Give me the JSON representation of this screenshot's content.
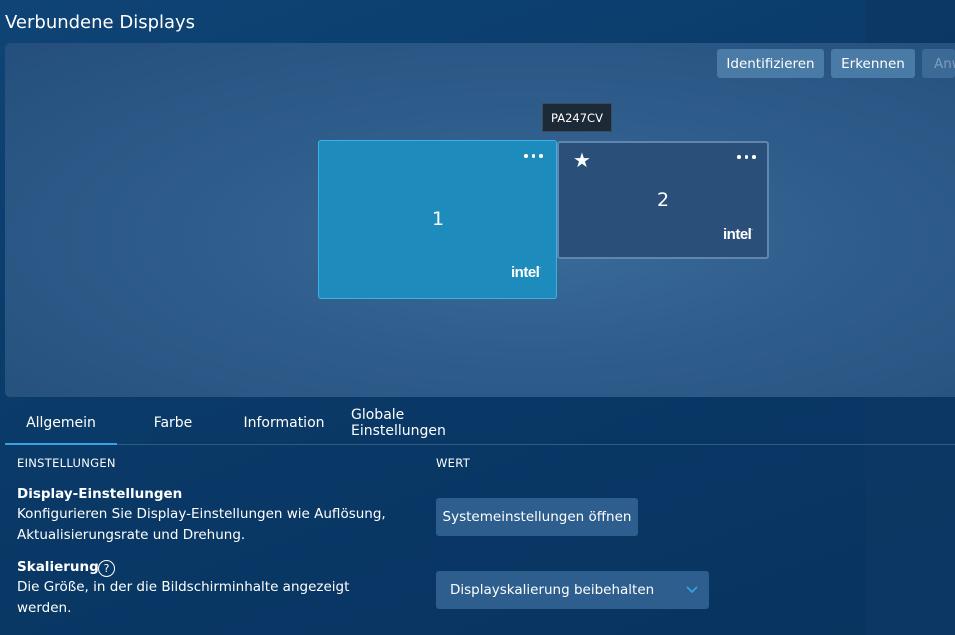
{
  "header": {
    "title": "Verbundene Displays"
  },
  "toolbar": {
    "identify_label": "Identifizieren",
    "detect_label": "Erkennen",
    "apply_label": "Anwenden"
  },
  "tooltip": {
    "text": "PA247CV"
  },
  "displays": [
    {
      "number": "1",
      "brand": "intel",
      "selected": true,
      "primary": false
    },
    {
      "number": "2",
      "brand": "intel",
      "selected": false,
      "primary": true
    }
  ],
  "tabs": [
    {
      "label": "Allgemein",
      "active": true
    },
    {
      "label": "Farbe",
      "active": false
    },
    {
      "label": "Information",
      "active": false
    },
    {
      "label": "Globale Einstellungen",
      "active": false
    }
  ],
  "settings": {
    "col_settings": "EINSTELLUNGEN",
    "col_value": "WERT",
    "rows": [
      {
        "title": "Display-Einstellungen",
        "desc_line1": "Konfigurieren Sie Display-Einstellungen wie Auflösung,",
        "desc_line2": "Aktualisierungsrate und Drehung.",
        "value": "Systemeinstellungen öffnen"
      },
      {
        "title": "Skalierung",
        "help": "?",
        "desc_line1": "Die Größe, in der die Bildschirminhalte angezeigt",
        "desc_line2": "werden.",
        "value": "Displayskalierung beibehalten"
      }
    ]
  },
  "colors": {
    "background": "#0b3a6a",
    "accent": "#36a4e0",
    "selected_display": "#1e8bbd",
    "display": "#2a5079"
  }
}
